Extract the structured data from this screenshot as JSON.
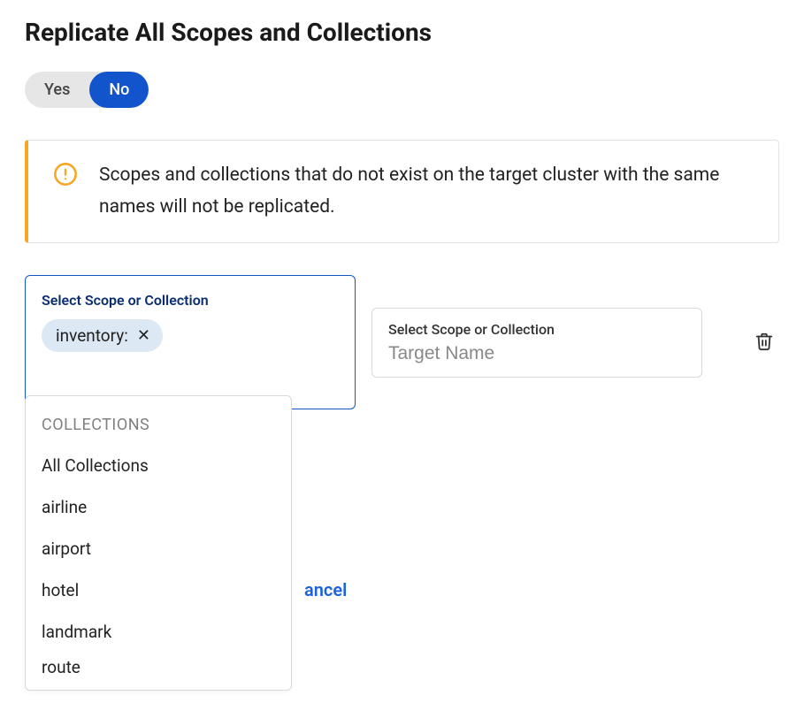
{
  "title": "Replicate All Scopes and Collections",
  "toggle": {
    "yes_label": "Yes",
    "no_label": "No"
  },
  "alert": {
    "text": "Scopes and collections that do not exist on the target cluster with the same names will not be replicated."
  },
  "source": {
    "label": "Select Scope or Collection",
    "chip": "inventory:"
  },
  "target": {
    "label": "Select Scope or Collection",
    "placeholder": "Target Name"
  },
  "dropdown": {
    "header": "COLLECTIONS",
    "items": {
      "0": "All Collections",
      "1": "airline",
      "2": "airport",
      "3": "hotel",
      "4": "landmark",
      "5": "route"
    }
  },
  "cancel_label": "ancel"
}
